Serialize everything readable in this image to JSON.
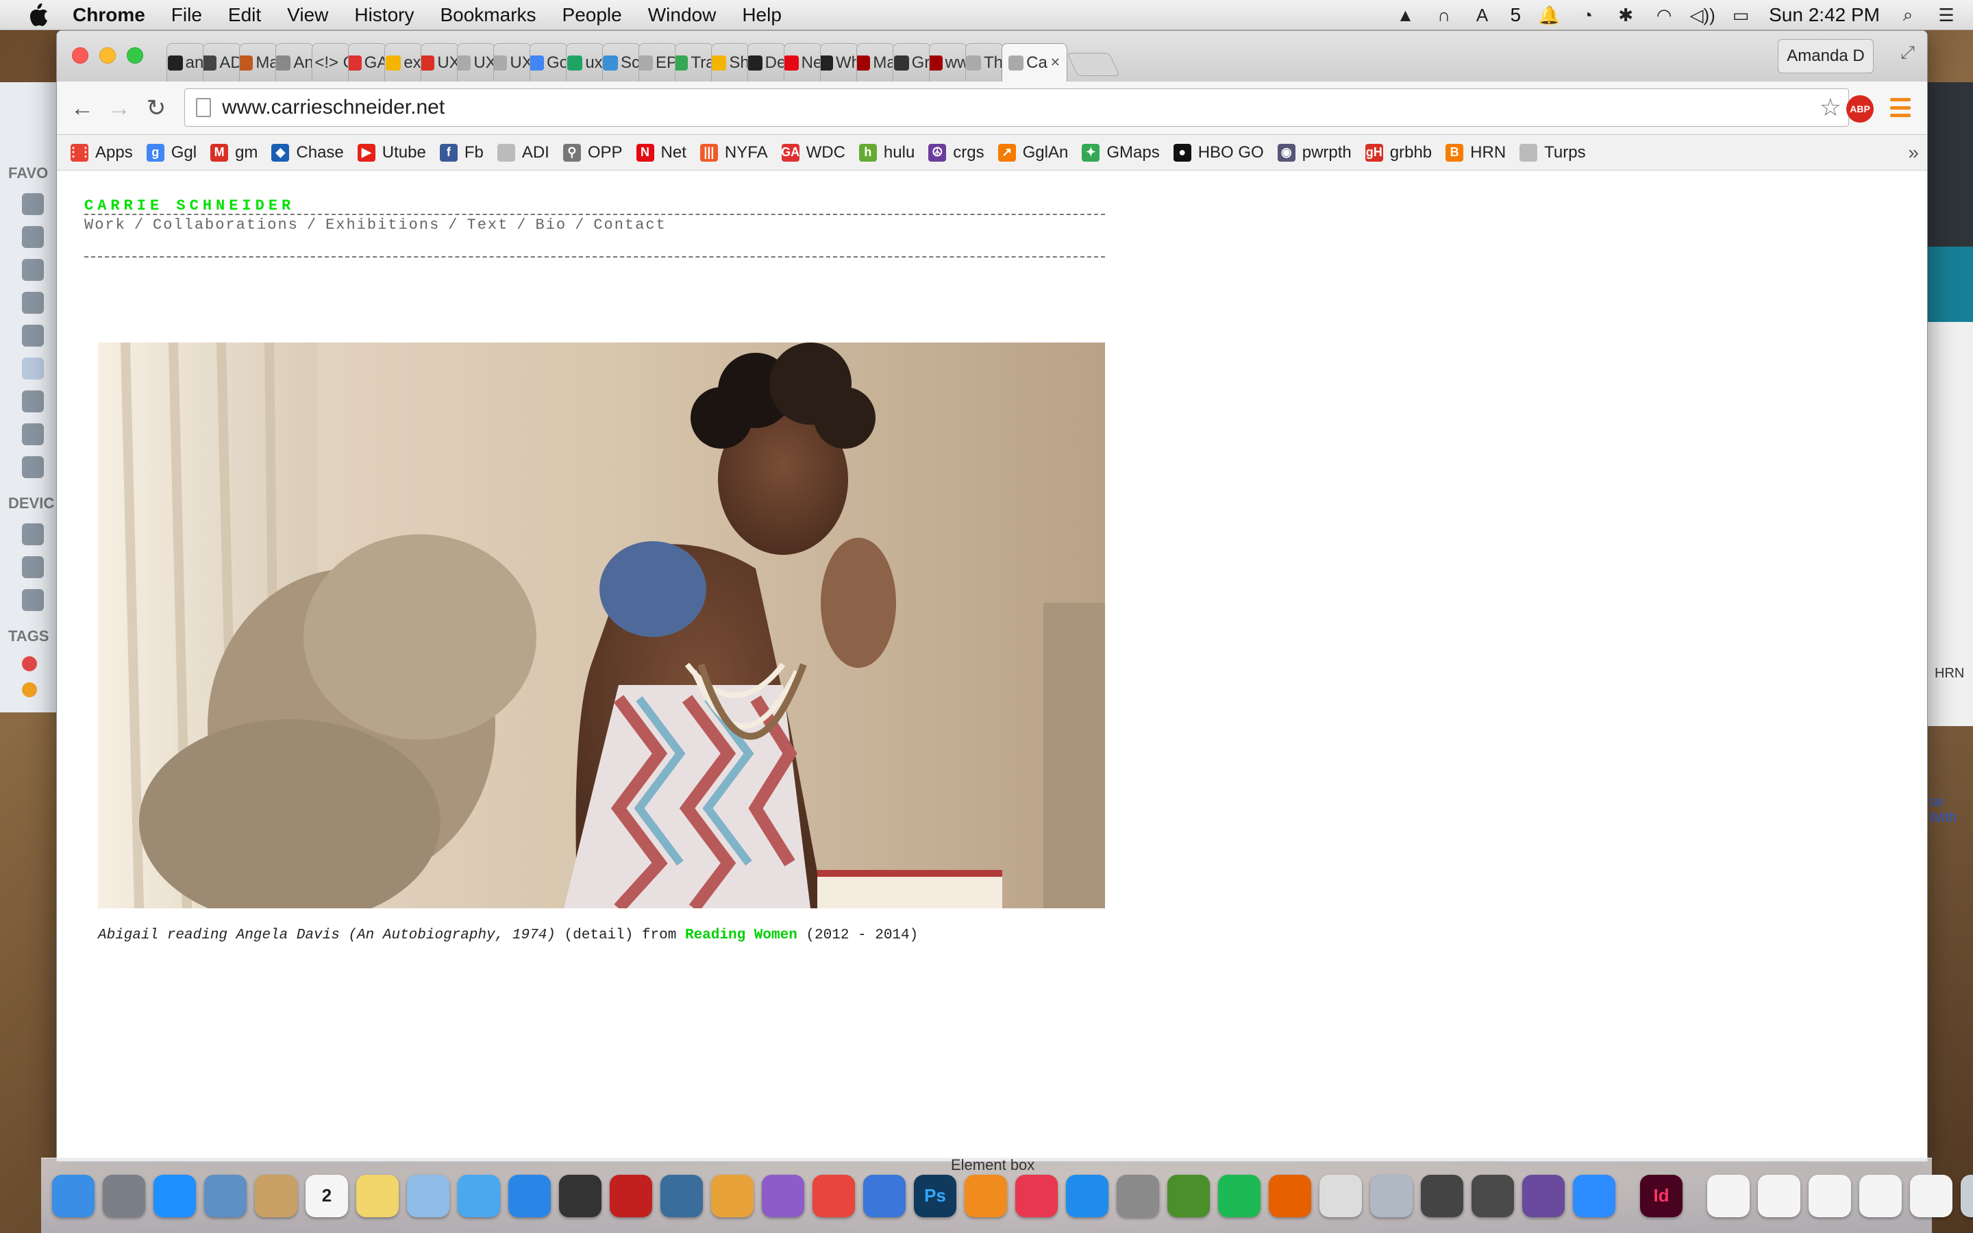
{
  "menubar": {
    "app": "Chrome",
    "items": [
      "File",
      "Edit",
      "View",
      "History",
      "Bookmarks",
      "People",
      "Window",
      "Help"
    ],
    "adobe_count": "5",
    "clock": "Sun 2:42 PM"
  },
  "window": {
    "profile": "Amanda D",
    "tabs": [
      {
        "label": "an",
        "color": "#222222"
      },
      {
        "label": "AD",
        "color": "#444444"
      },
      {
        "label": "Ma",
        "color": "#c05a1e"
      },
      {
        "label": "An",
        "color": "#888888"
      },
      {
        "label": "<!> Ge",
        "color": "#555555"
      },
      {
        "label": "GA",
        "color": "#e03030"
      },
      {
        "label": "ex",
        "color": "#f4b400"
      },
      {
        "label": "UX",
        "color": "#d93025"
      },
      {
        "label": "UX",
        "color": "#aaaaaa"
      },
      {
        "label": "UX",
        "color": "#aaaaaa"
      },
      {
        "label": "Go",
        "color": "#4285f4"
      },
      {
        "label": "ux",
        "color": "#1fa463"
      },
      {
        "label": "Sc",
        "color": "#3b8fd6"
      },
      {
        "label": "EP",
        "color": "#aaaaaa"
      },
      {
        "label": "Tra",
        "color": "#34a853"
      },
      {
        "label": "Sh",
        "color": "#f4b400"
      },
      {
        "label": "De",
        "color": "#222222"
      },
      {
        "label": "Ne",
        "color": "#e50914"
      },
      {
        "label": "Wh",
        "color": "#222222"
      },
      {
        "label": "Ma",
        "color": "#a00000"
      },
      {
        "label": "Gr",
        "color": "#333333"
      },
      {
        "label": "ww",
        "color": "#a00000"
      },
      {
        "label": "Th",
        "color": "#aaaaaa"
      },
      {
        "label": "Ca",
        "color": "#aaaaaa"
      }
    ],
    "url": "www.carrieschneider.net",
    "abp_label": "ABP"
  },
  "bookmarks": [
    {
      "label": "Apps",
      "color": "#e94235",
      "glyph": "⋮⋮"
    },
    {
      "label": "Ggl",
      "color": "#4285f4",
      "glyph": "g"
    },
    {
      "label": "gm",
      "color": "#d93025",
      "glyph": "M"
    },
    {
      "label": "Chase",
      "color": "#1a5fb4",
      "glyph": "◆"
    },
    {
      "label": "Utube",
      "color": "#e62117",
      "glyph": "▶"
    },
    {
      "label": "Fb",
      "color": "#3b5998",
      "glyph": "f"
    },
    {
      "label": "ADI",
      "color": "#bbbbbb",
      "glyph": ""
    },
    {
      "label": "OPP",
      "color": "#777777",
      "glyph": "⚲"
    },
    {
      "label": "Net",
      "color": "#e50914",
      "glyph": "N"
    },
    {
      "label": "NYFA",
      "color": "#f05a28",
      "glyph": "|||"
    },
    {
      "label": "WDC",
      "color": "#e03030",
      "glyph": "GA"
    },
    {
      "label": "hulu",
      "color": "#66aa33",
      "glyph": "h"
    },
    {
      "label": "crgs",
      "color": "#6a3d9a",
      "glyph": "☮"
    },
    {
      "label": "GglAn",
      "color": "#f57c00",
      "glyph": "↗"
    },
    {
      "label": "GMaps",
      "color": "#34a853",
      "glyph": "✦"
    },
    {
      "label": "HBO GO",
      "color": "#111111",
      "glyph": "●"
    },
    {
      "label": "pwrpth",
      "color": "#555577",
      "glyph": "◉"
    },
    {
      "label": "grbhb",
      "color": "#d93025",
      "glyph": "gH"
    },
    {
      "label": "HRN",
      "color": "#f57d00",
      "glyph": "B"
    },
    {
      "label": "Turps",
      "color": "#bbbbbb",
      "glyph": ""
    }
  ],
  "site": {
    "title": "CARRIE SCHNEIDER",
    "nav": [
      "Work",
      "Collaborations",
      "Exhibitions",
      "Text",
      "Bio",
      "Contact"
    ],
    "caption_italic": "Abigail reading Angela Davis (An Autobiography, 1974)",
    "caption_detail": "(detail) from",
    "caption_link": "Reading Women",
    "caption_years": "(2012 - 2014)"
  },
  "background_windows": {
    "finder_favorites": "FAVO",
    "finder_devices": "DEVIC",
    "finder_tags": "TAGS",
    "right_hrn": "HRN",
    "right_link": "se With"
  },
  "dock": {
    "calendar_day": "2",
    "ps_label": "Ps",
    "id_label": "Id",
    "hover_label": "Element box",
    "apps": [
      {
        "name": "Finder",
        "color": "#3a8ee6"
      },
      {
        "name": "Launchpad",
        "color": "#7a7f88"
      },
      {
        "name": "Safari",
        "color": "#1e90ff"
      },
      {
        "name": "Mail",
        "color": "#5e8fc5"
      },
      {
        "name": "Contacts",
        "color": "#c9a066"
      },
      {
        "name": "Calendar",
        "color": "#f5f5f5"
      },
      {
        "name": "Notes",
        "color": "#f2d56b"
      },
      {
        "name": "Preview",
        "color": "#8fbde8"
      },
      {
        "name": "Messages",
        "color": "#4aa8ee"
      },
      {
        "name": "Dropbox",
        "color": "#2a86e6"
      },
      {
        "name": "Screenshot",
        "color": "#333333"
      },
      {
        "name": "Photo Booth",
        "color": "#c21f1f"
      },
      {
        "name": "iPhoto",
        "color": "#3a6d9c"
      },
      {
        "name": "Pages",
        "color": "#e8a23a"
      },
      {
        "name": "Numbers",
        "color": "#8c5cc9"
      },
      {
        "name": "Chrome",
        "color": "#e8453c"
      },
      {
        "name": "Keynote",
        "color": "#3a77d9"
      },
      {
        "name": "Photoshop",
        "color": "#0f3a5e"
      },
      {
        "name": "iBooks",
        "color": "#f28b1d"
      },
      {
        "name": "iTunes",
        "color": "#e8384f"
      },
      {
        "name": "App Store",
        "color": "#1f8ceb"
      },
      {
        "name": "System Preferences",
        "color": "#8a8a8a"
      },
      {
        "name": "Maps",
        "color": "#4a8f2a"
      },
      {
        "name": "Spotify",
        "color": "#1db954"
      },
      {
        "name": "Firefox",
        "color": "#e66000"
      },
      {
        "name": "TextEdit",
        "color": "#dcdcdc"
      },
      {
        "name": "Image Capture",
        "color": "#b0b8c4"
      },
      {
        "name": "X11",
        "color": "#444444"
      },
      {
        "name": "Sublime",
        "color": "#4a4a4a"
      },
      {
        "name": "GitHub",
        "color": "#6a4a9c"
      },
      {
        "name": "Zoom",
        "color": "#2d8cff"
      },
      {
        "name": "InDesign",
        "color": "#49021f"
      }
    ]
  }
}
